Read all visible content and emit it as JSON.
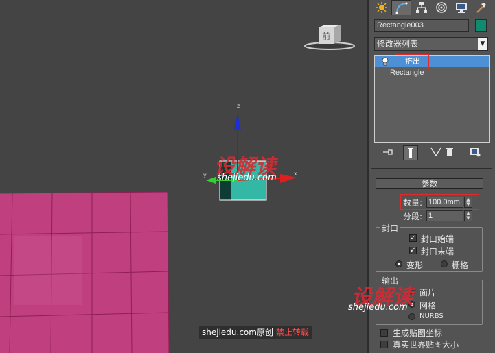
{
  "viewport": {
    "viewcube_label": "前",
    "gizmo": {
      "z_label": "z",
      "y_label": "y",
      "x_label": "x"
    },
    "watermark": "设解读",
    "watermark_url": "shejiedu.com",
    "credit": {
      "site": "shejiedu.com",
      "original": "原创",
      "forbid": "禁止转载"
    }
  },
  "panel": {
    "tabs": [
      {
        "icon": "create-icon"
      },
      {
        "icon": "modify-icon"
      },
      {
        "icon": "hierarchy-icon"
      },
      {
        "icon": "motion-icon"
      },
      {
        "icon": "display-icon"
      },
      {
        "icon": "utilities-icon"
      }
    ],
    "object_name": "Rectangle003",
    "object_color": "#0f8c6e",
    "modifier_list": "修改器列表",
    "stack": [
      {
        "label": "挤出",
        "selected": true
      },
      {
        "label": "Rectangle",
        "selected": false
      }
    ],
    "parameters": {
      "title": "参数",
      "amount_label": "数量:",
      "amount_value": "100.0mm",
      "segments_label": "分段:",
      "segments_value": "1",
      "capping": {
        "title": "封口",
        "cap_start": "封口始端",
        "cap_end": "封口末端",
        "morph": "变形",
        "grid": "栅格"
      },
      "output": {
        "title": "输出",
        "patch": "面片",
        "mesh": "网格",
        "nurbs": "NURBS"
      },
      "gen_mapping": "生成贴图坐标",
      "real_world": "真实世界贴图大小"
    }
  }
}
